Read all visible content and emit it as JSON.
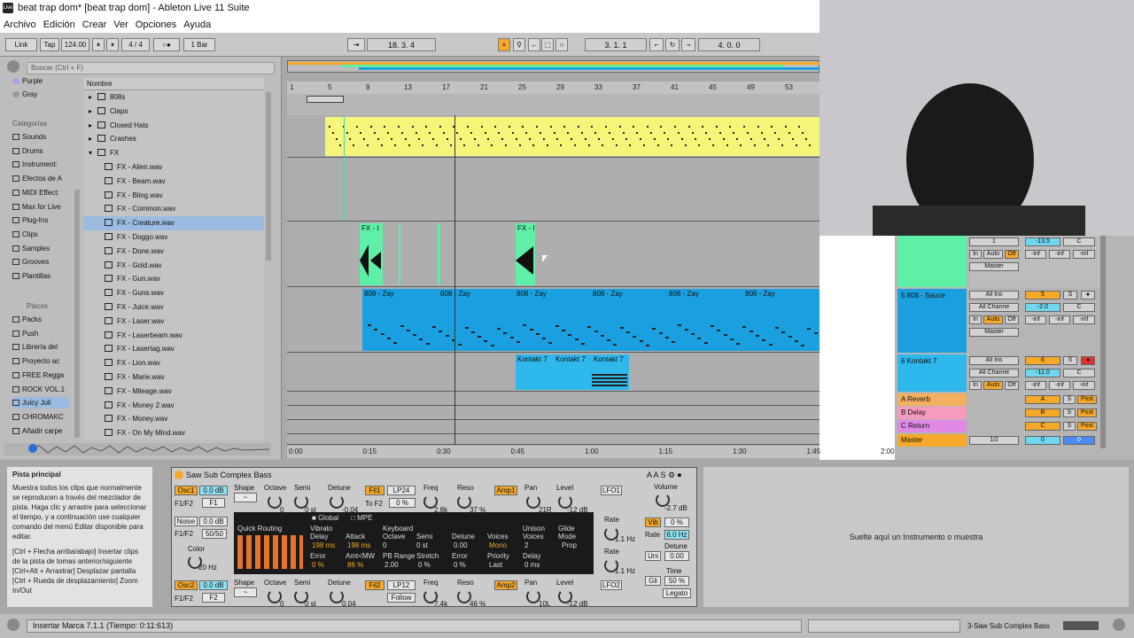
{
  "window": {
    "title": "beat trap dom*  [beat trap dom] - Ableton Live 11 Suite",
    "icon": "live-icon"
  },
  "menu": [
    "Archivo",
    "Edición",
    "Crear",
    "Ver",
    "Opciones",
    "Ayuda"
  ],
  "control_bar": {
    "link": "Link",
    "tap": "Tap",
    "tempo": "124.00",
    "signature": "4 / 4",
    "metronome": "○●",
    "quantize": "1 Bar",
    "position": "18.  3.  4",
    "loop_start": "3.  1.  1",
    "loop_length": "4.  0.  0"
  },
  "browser": {
    "search_placeholder": "Buscar (Ctrl + F)",
    "colors": [
      "Purple",
      "Gray"
    ],
    "categories_title": "Categorías",
    "categories": [
      "Sounds",
      "Drums",
      "Instrument:",
      "Efectos de A",
      "MIDI Effect:",
      "Max for Live",
      "Plug-Ins",
      "Clips",
      "Samples",
      "Grooves",
      "Plantillas"
    ],
    "places_title": "Places",
    "places": [
      "Packs",
      "Push",
      "Librería del",
      "Proyecto ac",
      "FREE Regga",
      "ROCK VOL.1",
      "Juicy Juli",
      "CHROMAKC",
      "Añadir carpe"
    ],
    "column_header": "Nombre",
    "items": [
      {
        "name": "808s",
        "type": "folder"
      },
      {
        "name": "Claps",
        "type": "folder"
      },
      {
        "name": "Closed Hats",
        "type": "folder"
      },
      {
        "name": "Crashes",
        "type": "folder"
      },
      {
        "name": "FX",
        "type": "folder-open"
      },
      {
        "name": "FX - Alien.wav",
        "type": "file"
      },
      {
        "name": "FX - Beam.wav",
        "type": "file"
      },
      {
        "name": "FX - Bling.wav",
        "type": "file"
      },
      {
        "name": "FX - Common.wav",
        "type": "file"
      },
      {
        "name": "FX - Creature.wav",
        "type": "file",
        "selected": true
      },
      {
        "name": "FX - Doggo.wav",
        "type": "file"
      },
      {
        "name": "FX - Done.wav",
        "type": "file"
      },
      {
        "name": "FX - Gold.wav",
        "type": "file"
      },
      {
        "name": "FX - Gun.wav",
        "type": "file"
      },
      {
        "name": "FX - Guns.wav",
        "type": "file"
      },
      {
        "name": "FX - Juice.wav",
        "type": "file"
      },
      {
        "name": "FX - Laser.wav",
        "type": "file"
      },
      {
        "name": "FX - Laserbeam.wav",
        "type": "file"
      },
      {
        "name": "FX - Lasertag.wav",
        "type": "file"
      },
      {
        "name": "FX - Lion.wav",
        "type": "file"
      },
      {
        "name": "FX - Marie.wav",
        "type": "file"
      },
      {
        "name": "FX - Mileage.wav",
        "type": "file"
      },
      {
        "name": "FX - Money 2.wav",
        "type": "file"
      },
      {
        "name": "FX - Money.wav",
        "type": "file"
      },
      {
        "name": "FX - On My Mind.wav",
        "type": "file"
      }
    ]
  },
  "arrangement": {
    "bar_ticks": [
      "1",
      "5",
      "9",
      "13",
      "17",
      "21",
      "25",
      "29",
      "33",
      "37",
      "41",
      "45",
      "49",
      "53"
    ],
    "time_ticks": [
      "0:00",
      "0:15",
      "0:30",
      "0:45",
      "1:00",
      "1:15",
      "1:30",
      "1:45",
      "2:00"
    ],
    "clips": {
      "fx1": "FX - I",
      "fx2": "FX - I",
      "bass": [
        "808 - Zay",
        "808 - Zay",
        "808 - Zay",
        "808 - Zay",
        "808 - Zay",
        "808 - Zay"
      ],
      "kontakt": [
        "Kontakt 7",
        "Kontakt 7",
        "Kontakt 7"
      ]
    },
    "colors": {
      "drums": "#f5f57a",
      "fx": "#5df0a6",
      "bass": "#1aa0e0",
      "kontakt": "#2fb8ec"
    }
  },
  "mixer": {
    "page": "2/1",
    "fx_track": {
      "route": "1",
      "volume": "-13.5",
      "pan": "C",
      "peaks": [
        "-inf",
        "-inf",
        "-inf"
      ],
      "output": "Master"
    },
    "tracks": [
      {
        "name": "5 808 - Sauce",
        "in": "All Ins",
        "chan": "All Channe",
        "num": "5",
        "s": "S",
        "volume": "-2.0",
        "pan": "C",
        "peaks": [
          "-inf",
          "-inf",
          "-inf"
        ],
        "output": "Master"
      },
      {
        "name": "6 Kontakt 7",
        "in": "All Ins",
        "chan": "All Channe",
        "num": "6",
        "s": "S",
        "volume": "-11.0",
        "pan": "C",
        "peaks": [
          "-inf",
          "-inf",
          "-inf"
        ]
      }
    ],
    "monitor": [
      "In",
      "Auto",
      "Off"
    ],
    "returns": [
      {
        "name": "A Reverb",
        "letter": "A",
        "color": "#f3b060"
      },
      {
        "name": "B Delay",
        "letter": "B",
        "color": "#f79ac0"
      },
      {
        "name": "C Return",
        "letter": "C",
        "color": "#e08ae6"
      }
    ],
    "master": {
      "name": "Master",
      "route": "1/2",
      "vol": "0",
      "pan": "0"
    },
    "post": "Post",
    "s": "S"
  },
  "info_view": {
    "title": "Pista principal",
    "body": "Muestra todos los clips que normalmente se reproducen a través del mezclador de pista. Haga clic y arrastre para seleccionar el tiempo, y a continuación use cualquier comando del menú Editar disponible para editar.",
    "shortcuts": "[Ctrl + Flecha arriba/abajo] Insertar clips de la pista de tomas anterior/siguiente [Ctrl+Alt + Arrastrar] Desplazar pantalla [Ctrl + Rueda de desplazamiento] Zoom In/Out"
  },
  "device": {
    "name": "Saw Sub Complex Bass",
    "osc1": {
      "label": "Osc1",
      "gain": "0.0 dB",
      "f": "F1/F2",
      "fval": "F1",
      "shape": "Shape",
      "octave": "Octave",
      "oct_val": "0",
      "semi": "Semi",
      "semi_val": "0 st",
      "detune": "Detune",
      "detune_val": "-0.04"
    },
    "fil1": {
      "label": "Fil1",
      "type": "LP24",
      "to": "To F2",
      "to_val": "0 %",
      "freq": "Freq",
      "freq_val": "2.8k",
      "reso": "Reso",
      "reso_val": "37 %"
    },
    "amp1": {
      "label": "Amp1",
      "pan": "Pan",
      "pan_val": "21R",
      "level": "Level",
      "level_val": "-12 dB"
    },
    "lfo1": "LFO1",
    "volume": {
      "label": "Volume",
      "value": "-2.7 dB"
    },
    "noise": {
      "label": "Noise",
      "gain": "0.0 dB",
      "f": "F1/F2",
      "fval": "50/50",
      "color": "Color",
      "color_val": "20 Hz"
    },
    "quick_routing": "Quick Routing",
    "global": "Global",
    "mpe": "MPE",
    "vibrato": "Vibrato",
    "keyboard": "Keyboard",
    "unison": "Unison",
    "glide": "Glide",
    "delay": "Delay",
    "delay_val": "198 ms",
    "attack": "Attack",
    "attack_val": "198 ms",
    "error": "Error",
    "error_val": "0 %",
    "amt": "Amt<MW",
    "amt_val": "86 %",
    "octave_k": "Octave",
    "octave_k_val": "0",
    "semi_k": "Semi",
    "semi_k_val": "0 st",
    "pbrange": "PB Range",
    "pbrange_val": "2.00",
    "stretch": "Stretch",
    "stretch_val": "0 %",
    "detune_k": "Detune",
    "detune_k_val": "0.00",
    "error_k": "Error",
    "error_k_val": "0 %",
    "voices": "Voices",
    "voices_val": "Mono",
    "priority": "Priority",
    "priority_val": "Last",
    "u_voices": "Voices",
    "u_voices_val": "2",
    "u_delay": "Delay",
    "u_delay_val": "0 ms",
    "mode": "Mode",
    "mode_val": "Prop",
    "rate": "Rate",
    "rate1": "1.1 Hz",
    "rate2": "1.1 Hz",
    "vib": "Vib",
    "vib_val": "0 %",
    "vib_rate": "Rate",
    "vib_rate_val": "6.0 Hz",
    "uni": "Uni",
    "uni_detune": "Detune",
    "uni_detune_val": "0.00",
    "gli": "Gli",
    "time": "Time",
    "time_val": "50 %",
    "legato": "Legato",
    "osc2": {
      "label": "Osc2",
      "gain": "0.0 dB",
      "f": "F1/F2",
      "fval": "F2",
      "octave_val": "0",
      "semi_val": "0 st",
      "detune_val": "0.04"
    },
    "fil2": {
      "label": "Fil2",
      "type": "LP12",
      "follow": "Follow",
      "freq_val": "7.4k",
      "reso_val": "46 %"
    },
    "amp2": {
      "label": "Amp2",
      "pan_val": "10L",
      "level_val": "-12 dB"
    },
    "lfo2": "LFO2"
  },
  "drop_zone": "Suelte aquí un Instrumento o muestra",
  "status": {
    "text": "Insertar Marca 7.1.1 (Tiempo: 0:11:613)",
    "track": "3-Saw Sub Complex Bass"
  }
}
